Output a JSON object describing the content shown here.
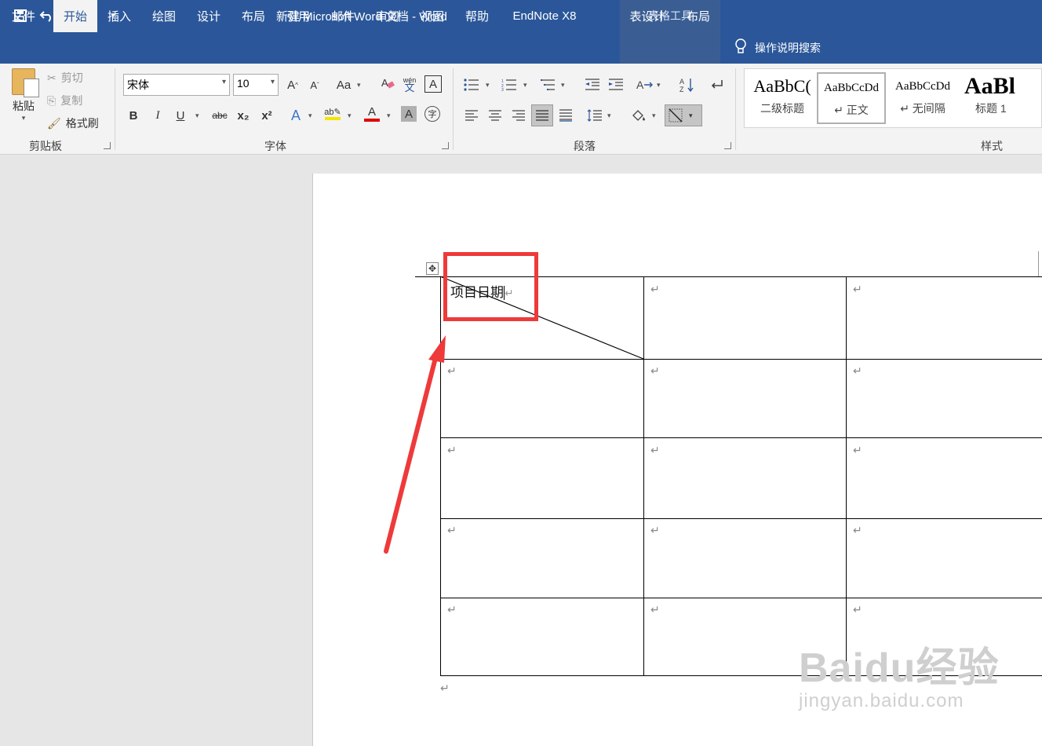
{
  "titlebar": {
    "title": "新建 Microsoft Word 文档 - Word",
    "context_tab_group": "表格工具",
    "qat": [
      "save-icon",
      "undo-icon",
      "redo-icon",
      "customize-icon"
    ]
  },
  "tabs": [
    "文件",
    "开始",
    "插入",
    "绘图",
    "设计",
    "布局",
    "引用",
    "邮件",
    "审阅",
    "视图",
    "帮助",
    "EndNote X8",
    "表设计",
    "布局"
  ],
  "active_tab": "开始",
  "tell_me": "操作说明搜索",
  "clipboard": {
    "paste": "粘贴",
    "cut": "剪切",
    "copy": "复制",
    "format_painter": "格式刷",
    "label": "剪贴板"
  },
  "font": {
    "name": "宋体",
    "size": "10",
    "label": "字体",
    "bold": "B",
    "italic": "I",
    "underline": "U",
    "strike": "abc",
    "sub": "x₂",
    "sup": "x²",
    "grow": "A",
    "shrink": "A",
    "change_case": "Aa",
    "phonetic": "wén",
    "text_effects": "A",
    "font_color": "A",
    "char_shading": "A",
    "enclose": "字",
    "highlight_color": "#f5e400",
    "font_color_value": "#e00000"
  },
  "paragraph": {
    "label": "段落"
  },
  "styles": {
    "label": "样式",
    "items": [
      {
        "sample": "AaBbC(",
        "name": "二级标题"
      },
      {
        "sample": "AaBbCcDd",
        "name": "↵ 正文"
      },
      {
        "sample": "AaBbCcDd",
        "name": "↵ 无间隔"
      },
      {
        "sample": "AaBl",
        "name": "标题 1"
      }
    ]
  },
  "document": {
    "cell_text": "项目日期",
    "para_mark": "↵"
  },
  "watermark": {
    "logo": "Baidu经验",
    "sub": "jingyan.baidu.com"
  }
}
